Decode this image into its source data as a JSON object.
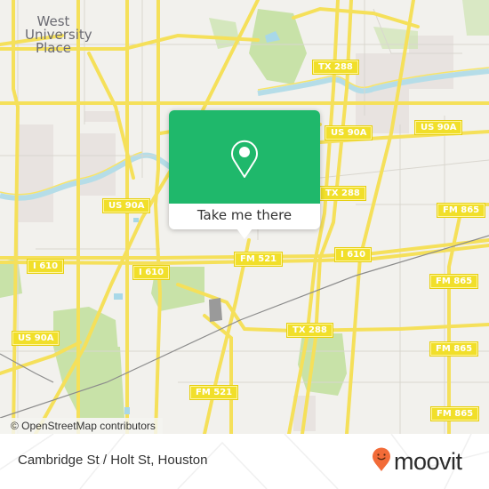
{
  "map": {
    "colors": {
      "background": "#f2f1ed",
      "road": "#f7e46a",
      "road_casing": "#e8d24a",
      "park": "#c5e1a5",
      "water": "#a8d8e8",
      "river": "#bfe3ec",
      "rail": "#8a8a8a",
      "landuse": "#e8e3e0"
    },
    "place_labels": [
      {
        "lines": [
          "West",
          "University",
          "Place"
        ]
      }
    ],
    "shields": [
      {
        "label": "TX 288"
      },
      {
        "label": "US 90A"
      },
      {
        "label": "US 90A"
      },
      {
        "label": "US 90A"
      },
      {
        "label": "TX 288"
      },
      {
        "label": "FM 865"
      },
      {
        "label": "I 610"
      },
      {
        "label": "I 610"
      },
      {
        "label": "FM 521"
      },
      {
        "label": "I 610"
      },
      {
        "label": "FM 865"
      },
      {
        "label": "US 90A"
      },
      {
        "label": "TX 288"
      },
      {
        "label": "FM 865"
      },
      {
        "label": "FM 521"
      },
      {
        "label": "FM 865"
      }
    ],
    "attribution": "© OpenStreetMap contributors"
  },
  "popup": {
    "accent": "#1fb86b",
    "icon": "map-pin-icon",
    "cta_label": "Take me there"
  },
  "footer": {
    "stop_name": "Cambridge St / Holt St, Houston",
    "brand": {
      "name": "moovit",
      "logo_color": "#f26b38",
      "icon": "moovit-smile-pin-icon"
    }
  }
}
